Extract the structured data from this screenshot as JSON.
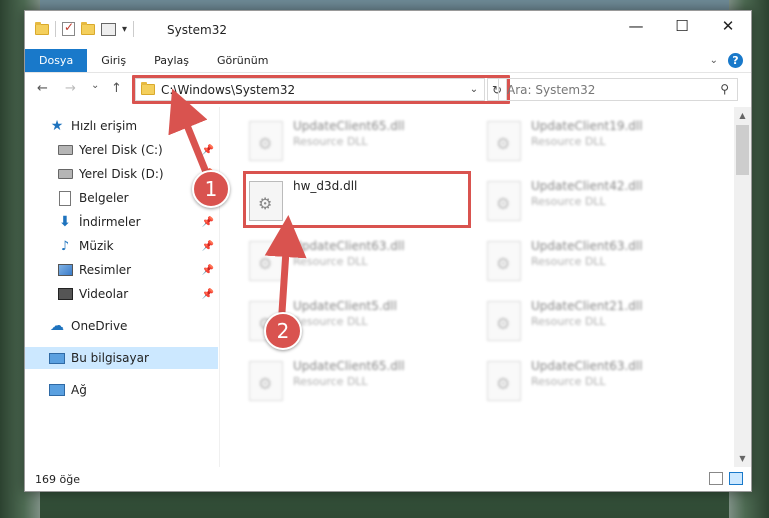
{
  "window": {
    "title": "System32",
    "min_glyph": "—",
    "max_glyph": "☐",
    "close_glyph": "✕"
  },
  "ribbon": {
    "tabs": [
      "Dosya",
      "Giriş",
      "Paylaş",
      "Görünüm"
    ],
    "help": "?"
  },
  "nav": {
    "back": "←",
    "forward": "→",
    "recent": "⌄",
    "up": "↑",
    "address": "C:\\Windows\\System32",
    "refresh": "↻",
    "search_placeholder": "Ara: System32",
    "search_icon": "⚲"
  },
  "sidebar": {
    "items": [
      {
        "label": "Hızlı erişim",
        "icon": "star-icon"
      },
      {
        "label": "Yerel Disk (C:)",
        "icon": "drive-icon",
        "pinned": true
      },
      {
        "label": "Yerel Disk (D:)",
        "icon": "drive-icon",
        "pinned": true
      },
      {
        "label": "Belgeler",
        "icon": "document-icon",
        "pinned": true
      },
      {
        "label": "İndirmeler",
        "icon": "download-icon",
        "pinned": true
      },
      {
        "label": "Müzik",
        "icon": "music-icon",
        "pinned": true
      },
      {
        "label": "Resimler",
        "icon": "pictures-icon",
        "pinned": true
      },
      {
        "label": "Videolar",
        "icon": "videos-icon",
        "pinned": true
      },
      {
        "label": "OneDrive",
        "icon": "cloud-icon"
      },
      {
        "label": "Bu bilgisayar",
        "icon": "computer-icon",
        "selected": true
      },
      {
        "label": "Ağ",
        "icon": "network-icon"
      }
    ]
  },
  "files": {
    "highlighted": {
      "name": "hw_d3d.dll",
      "type": ""
    },
    "left_col": [
      {
        "name": "UpdateClient65.dll",
        "type": "Resource DLL"
      },
      {
        "name": "UpdateClient63.dll",
        "type": "Resource DLL"
      },
      {
        "name": "UpdateClient5.dll",
        "type": "Resource DLL"
      },
      {
        "name": "UpdateClient65.dll",
        "type": "Resource DLL"
      }
    ],
    "right_col": [
      {
        "name": "UpdateClient19.dll",
        "type": "Resource DLL"
      },
      {
        "name": "UpdateClient42.dll",
        "type": "Resource DLL"
      },
      {
        "name": "UpdateClient63.dll",
        "type": "Resource DLL"
      },
      {
        "name": "UpdateClient21.dll",
        "type": "Resource DLL"
      },
      {
        "name": "UpdateClient63.dll",
        "type": "Resource DLL"
      }
    ]
  },
  "status": {
    "count": "169 öğe"
  },
  "annotations": {
    "badge1": "1",
    "badge2": "2",
    "color": "#d9534f"
  }
}
